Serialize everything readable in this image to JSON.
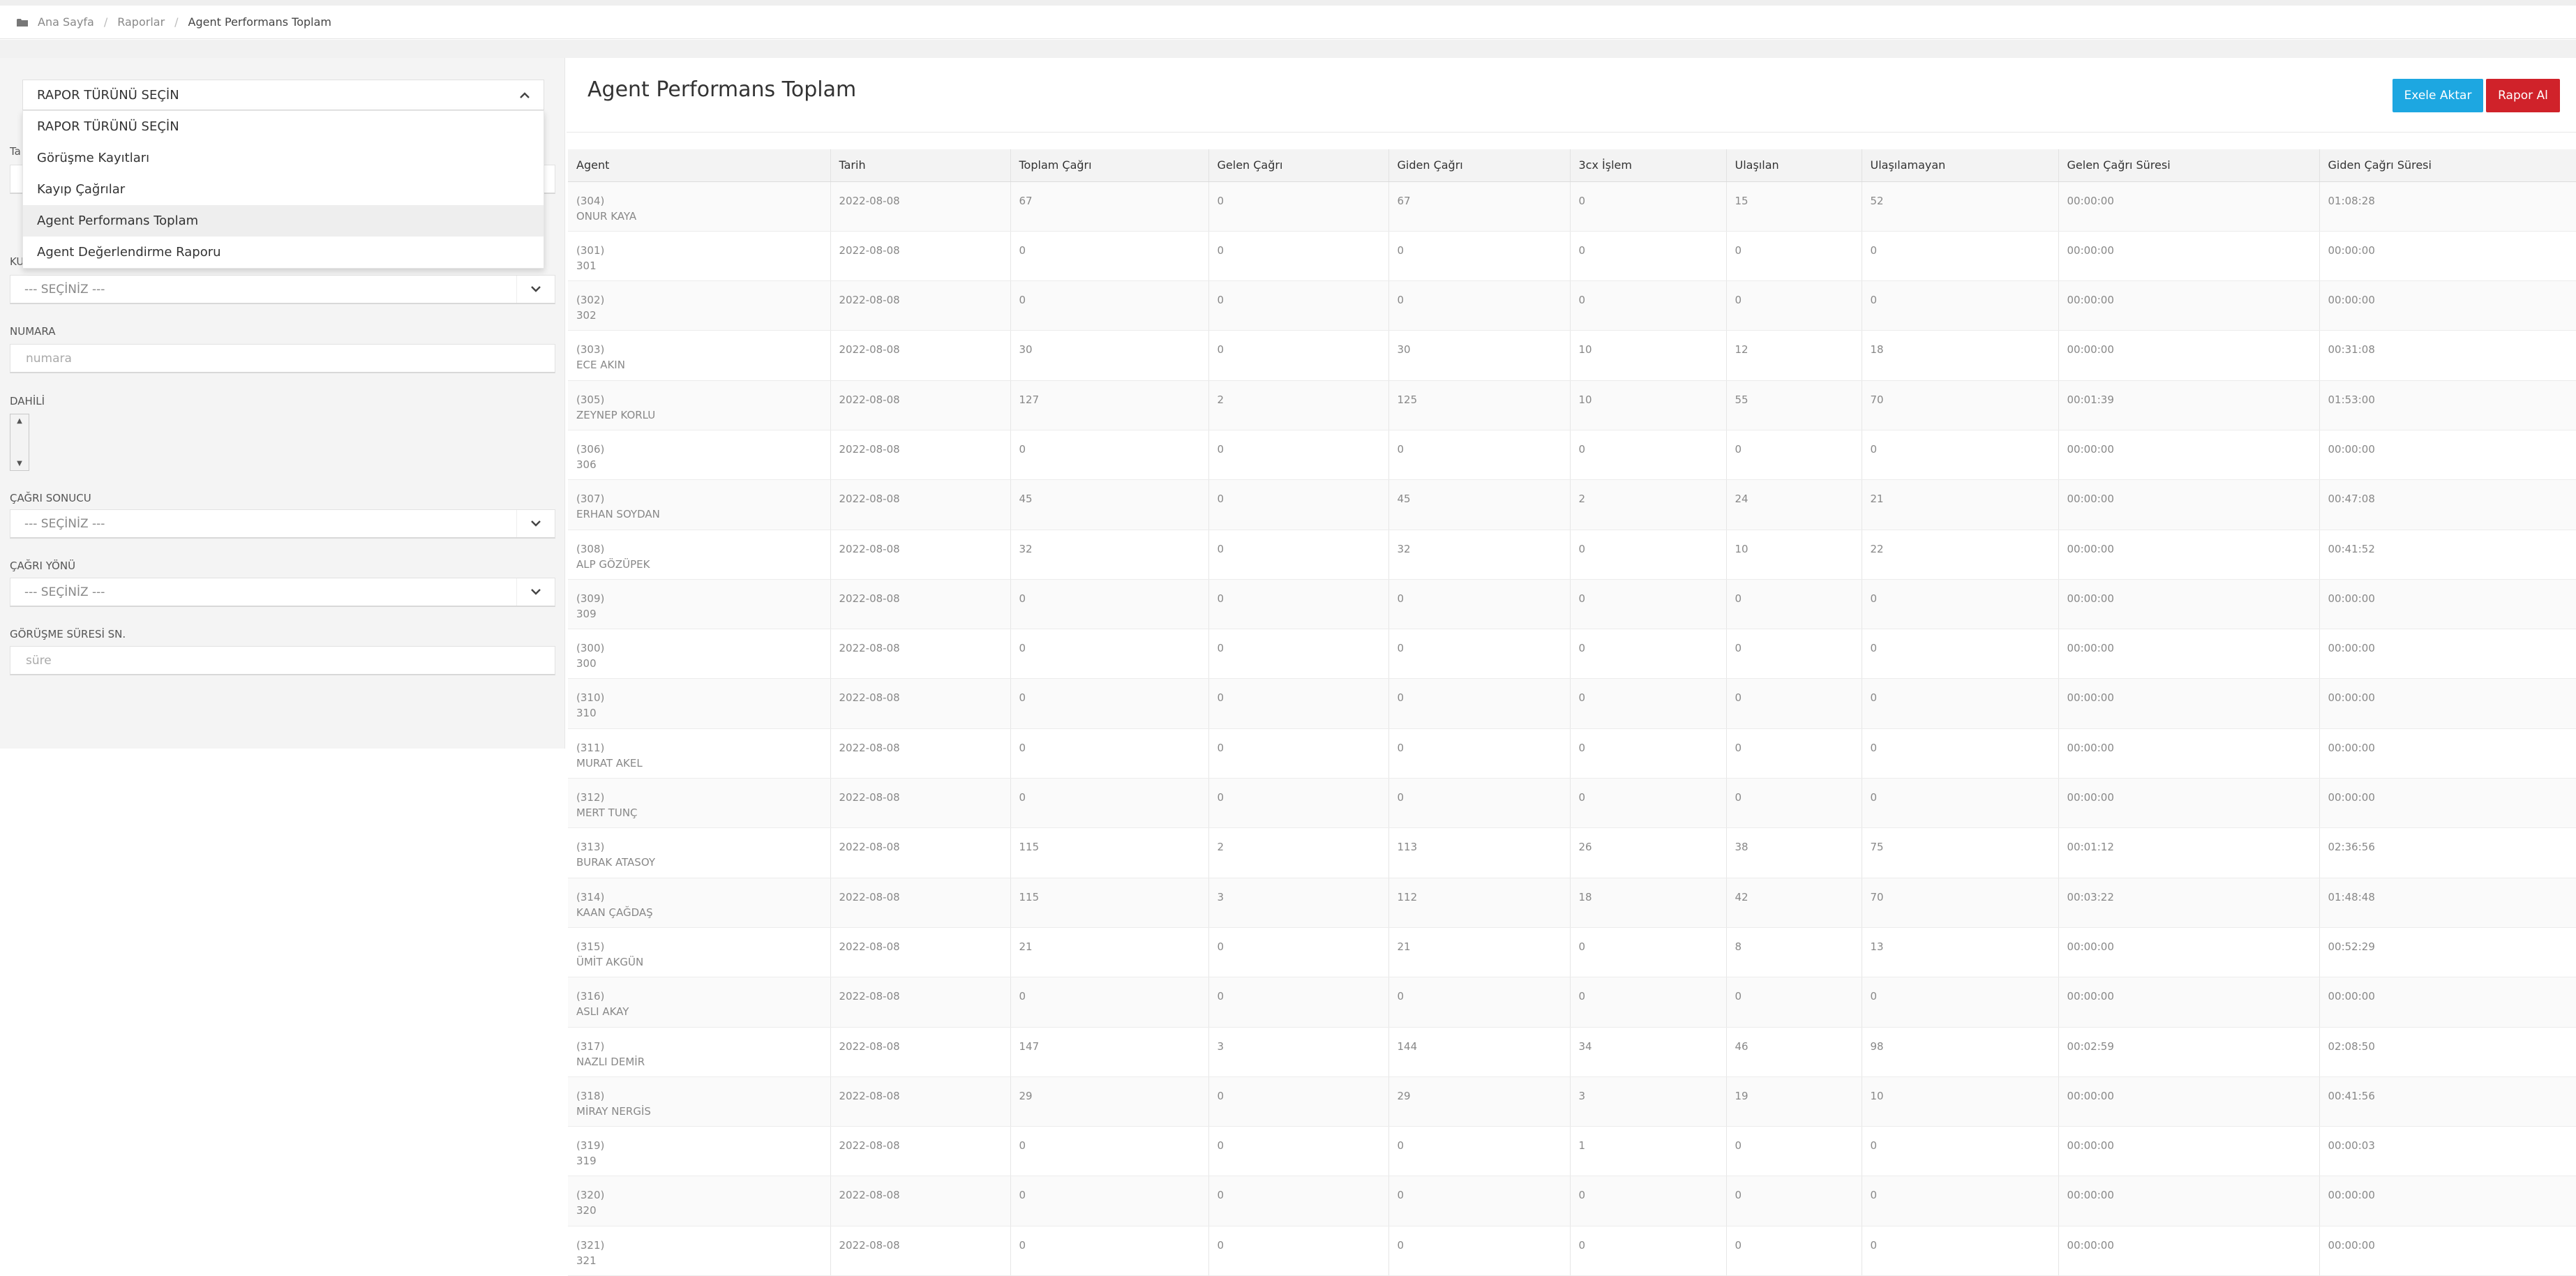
{
  "breadcrumb": {
    "home": "Ana Sayfa",
    "reports": "Raporlar",
    "current": "Agent Performans Toplam"
  },
  "report_select": {
    "selected": "RAPOR TÜRÜNÜ SEÇİN",
    "options": [
      "RAPOR TÜRÜNÜ SEÇİN",
      "Görüşme Kayıtları",
      "Kayıp Çağrılar",
      "Agent Performans Toplam",
      "Agent Değerlendirme Raporu"
    ]
  },
  "filters": {
    "label_partial_1": "Ta",
    "label_partial_2": "KU",
    "select_1": "--- SEÇİNİZ ---",
    "numara_label": "NUMARA",
    "numara_placeholder": "numara",
    "dahili_label": "DAHİLİ",
    "cagri_sonucu_label": "ÇAĞRI SONUCU",
    "cagri_sonucu_value": "--- SEÇİNİZ ---",
    "cagri_yonu_label": "ÇAĞRI YÖNÜ",
    "cagri_yonu_value": "--- SEÇİNİZ ---",
    "gorusme_label": "GÖRÜŞME SÜRESİ SN.",
    "gorusme_placeholder": "süre"
  },
  "main": {
    "title": "Agent Performans Toplam",
    "excel_button": "Exele Aktar",
    "report_button": "Rapor Al"
  },
  "table": {
    "headers": [
      "Agent",
      "Tarih",
      "Toplam Çağrı",
      "Gelen Çağrı",
      "Giden Çağrı",
      "3cx İşlem",
      "Ulaşılan",
      "Ulaşılamayan",
      "Gelen Çağrı Süresi",
      "Giden Çağrı Süresi"
    ],
    "rows": [
      [
        "(304)",
        "ONUR KAYA",
        "2022-08-08",
        "67",
        "0",
        "67",
        "0",
        "15",
        "52",
        "00:00:00",
        "01:08:28"
      ],
      [
        "(301)",
        "301",
        "2022-08-08",
        "0",
        "0",
        "0",
        "0",
        "0",
        "0",
        "00:00:00",
        "00:00:00"
      ],
      [
        "(302)",
        "302",
        "2022-08-08",
        "0",
        "0",
        "0",
        "0",
        "0",
        "0",
        "00:00:00",
        "00:00:00"
      ],
      [
        "(303)",
        "ECE AKIN",
        "2022-08-08",
        "30",
        "0",
        "30",
        "10",
        "12",
        "18",
        "00:00:00",
        "00:31:08"
      ],
      [
        "(305)",
        "ZEYNEP KORLU",
        "2022-08-08",
        "127",
        "2",
        "125",
        "10",
        "55",
        "70",
        "00:01:39",
        "01:53:00"
      ],
      [
        "(306)",
        "306",
        "2022-08-08",
        "0",
        "0",
        "0",
        "0",
        "0",
        "0",
        "00:00:00",
        "00:00:00"
      ],
      [
        "(307)",
        "ERHAN SOYDAN",
        "2022-08-08",
        "45",
        "0",
        "45",
        "2",
        "24",
        "21",
        "00:00:00",
        "00:47:08"
      ],
      [
        "(308)",
        "ALP GÖZÜPEK",
        "2022-08-08",
        "32",
        "0",
        "32",
        "0",
        "10",
        "22",
        "00:00:00",
        "00:41:52"
      ],
      [
        "(309)",
        "309",
        "2022-08-08",
        "0",
        "0",
        "0",
        "0",
        "0",
        "0",
        "00:00:00",
        "00:00:00"
      ],
      [
        "(300)",
        "300",
        "2022-08-08",
        "0",
        "0",
        "0",
        "0",
        "0",
        "0",
        "00:00:00",
        "00:00:00"
      ],
      [
        "(310)",
        "310",
        "2022-08-08",
        "0",
        "0",
        "0",
        "0",
        "0",
        "0",
        "00:00:00",
        "00:00:00"
      ],
      [
        "(311)",
        "MURAT AKEL",
        "2022-08-08",
        "0",
        "0",
        "0",
        "0",
        "0",
        "0",
        "00:00:00",
        "00:00:00"
      ],
      [
        "(312)",
        "MERT TUNÇ",
        "2022-08-08",
        "0",
        "0",
        "0",
        "0",
        "0",
        "0",
        "00:00:00",
        "00:00:00"
      ],
      [
        "(313)",
        "BURAK ATASOY",
        "2022-08-08",
        "115",
        "2",
        "113",
        "26",
        "38",
        "75",
        "00:01:12",
        "02:36:56"
      ],
      [
        "(314)",
        "KAAN ÇAĞDAŞ",
        "2022-08-08",
        "115",
        "3",
        "112",
        "18",
        "42",
        "70",
        "00:03:22",
        "01:48:48"
      ],
      [
        "(315)",
        "ÜMİT AKGÜN",
        "2022-08-08",
        "21",
        "0",
        "21",
        "0",
        "8",
        "13",
        "00:00:00",
        "00:52:29"
      ],
      [
        "(316)",
        "ASLI AKAY",
        "2022-08-08",
        "0",
        "0",
        "0",
        "0",
        "0",
        "0",
        "00:00:00",
        "00:00:00"
      ],
      [
        "(317)",
        "NAZLI DEMİR",
        "2022-08-08",
        "147",
        "3",
        "144",
        "34",
        "46",
        "98",
        "00:02:59",
        "02:08:50"
      ],
      [
        "(318)",
        "MİRAY NERGİS",
        "2022-08-08",
        "29",
        "0",
        "29",
        "3",
        "19",
        "10",
        "00:00:00",
        "00:41:56"
      ],
      [
        "(319)",
        "319",
        "2022-08-08",
        "0",
        "0",
        "0",
        "1",
        "0",
        "0",
        "00:00:00",
        "00:00:03"
      ],
      [
        "(320)",
        "320",
        "2022-08-08",
        "0",
        "0",
        "0",
        "0",
        "0",
        "0",
        "00:00:00",
        "00:00:00"
      ],
      [
        "(321)",
        "321",
        "2022-08-08",
        "0",
        "0",
        "0",
        "0",
        "0",
        "0",
        "00:00:00",
        "00:00:00"
      ]
    ]
  },
  "colors": {
    "excel": "#1da7e1",
    "report": "#d0222a"
  },
  "icons": {
    "home": "folder-home-icon",
    "chevron": "chevron-down-icon",
    "chevron_up": "chevron-up-icon"
  }
}
